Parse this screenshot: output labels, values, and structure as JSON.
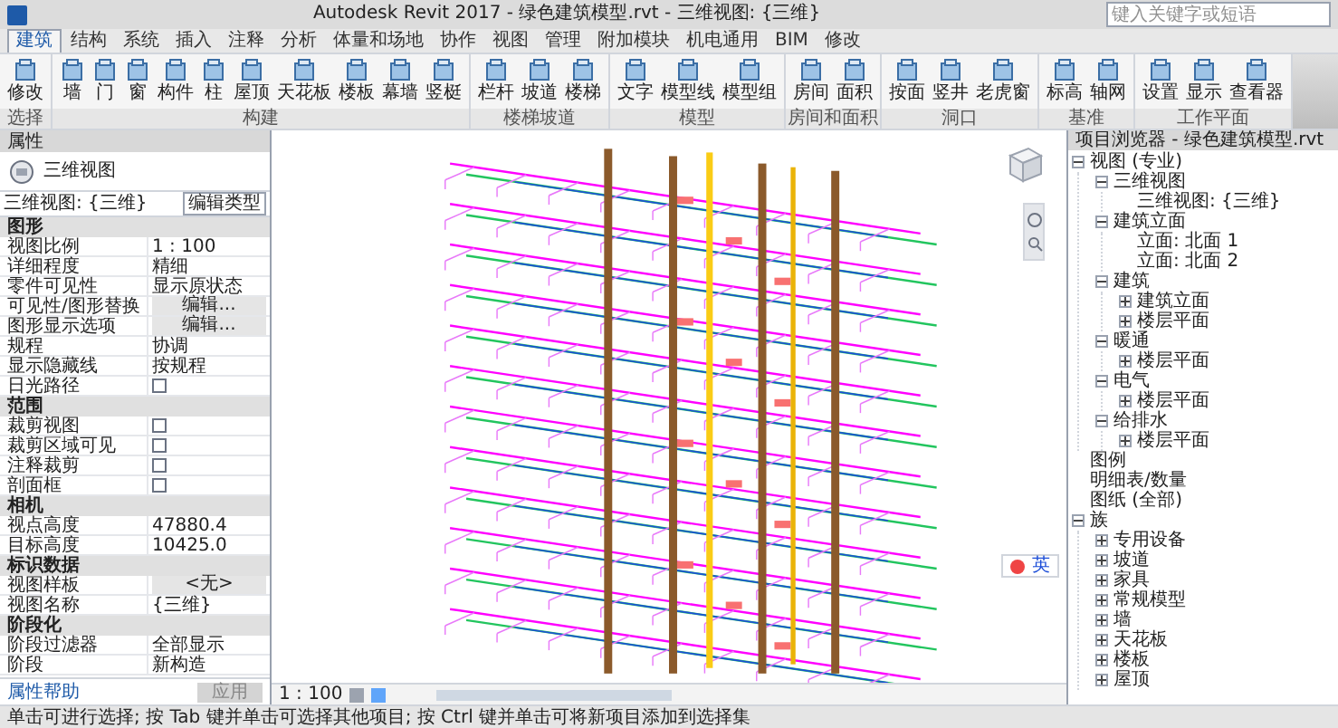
{
  "window": {
    "title": "Autodesk Revit 2017 -   绿色建筑模型.rvt - 三维视图: {三维}",
    "search": {
      "placeholder": "键入关键字或短语"
    }
  },
  "ribbon_tabs": [
    {
      "label": "建筑",
      "selected": true
    },
    {
      "label": "结构",
      "selected": false
    },
    {
      "label": "系统",
      "selected": false
    },
    {
      "label": "插入",
      "selected": false
    },
    {
      "label": "注释",
      "selected": false
    },
    {
      "label": "分析",
      "selected": false
    },
    {
      "label": "体量和场地",
      "selected": false
    },
    {
      "label": "协作",
      "selected": false
    },
    {
      "label": "视图",
      "selected": false
    },
    {
      "label": "管理",
      "selected": false
    },
    {
      "label": "附加模块",
      "selected": false
    },
    {
      "label": "机电通用",
      "selected": false
    },
    {
      "label": "BIM",
      "selected": false
    },
    {
      "label": "修改",
      "selected": false
    }
  ],
  "ribbon_panels": [
    {
      "label": "选择",
      "buttons": [
        "修改"
      ]
    },
    {
      "label": "构建",
      "buttons": [
        "墙",
        "门",
        "窗",
        "构件",
        "柱",
        "屋顶",
        "天花板",
        "楼板",
        "幕墙",
        "竖梃"
      ]
    },
    {
      "label": "楼梯坡道",
      "buttons": [
        "栏杆",
        "坡道",
        "楼梯"
      ]
    },
    {
      "label": "模型",
      "buttons": [
        "文字",
        "模型线",
        "模型组"
      ]
    },
    {
      "label": "房间和面积",
      "buttons": [
        "房间",
        "面积"
      ]
    },
    {
      "label": "洞口",
      "buttons": [
        "按面",
        "竖井",
        "老虎窗"
      ]
    },
    {
      "label": "基准",
      "buttons": [
        "标高",
        "轴网"
      ]
    },
    {
      "label": "工作平面",
      "buttons": [
        "设置",
        "显示",
        "查看器"
      ]
    }
  ],
  "properties": {
    "title": "属性",
    "type_name": "三维视图",
    "type_selector": "三维视图: {三维}",
    "edit_type": "编辑类型",
    "sections": [
      {
        "label": "图形",
        "rows": [
          {
            "kind": "text",
            "name": "视图比例",
            "value": "1 : 100"
          },
          {
            "kind": "text",
            "name": "详细程度",
            "value": "精细"
          },
          {
            "kind": "text",
            "name": "零件可见性",
            "value": "显示原状态"
          },
          {
            "kind": "button",
            "name": "可见性/图形替换",
            "value": "编辑..."
          },
          {
            "kind": "button",
            "name": "图形显示选项",
            "value": "编辑..."
          },
          {
            "kind": "text",
            "name": "规程",
            "value": "协调"
          },
          {
            "kind": "text",
            "name": "显示隐藏线",
            "value": "按规程"
          },
          {
            "kind": "checkbox",
            "name": "日光路径",
            "checked": false
          }
        ]
      },
      {
        "label": "范围",
        "rows": [
          {
            "kind": "checkbox",
            "name": "裁剪视图",
            "checked": false
          },
          {
            "kind": "checkbox",
            "name": "裁剪区域可见",
            "checked": false
          },
          {
            "kind": "checkbox",
            "name": "注释裁剪",
            "checked": false
          },
          {
            "kind": "checkbox",
            "name": "剖面框",
            "checked": false
          }
        ]
      },
      {
        "label": "相机",
        "rows": [
          {
            "kind": "text",
            "name": "视点高度",
            "value": "47880.4"
          },
          {
            "kind": "text",
            "name": "目标高度",
            "value": "10425.0"
          }
        ]
      },
      {
        "label": "标识数据",
        "rows": [
          {
            "kind": "button",
            "name": "视图样板",
            "value": "<无>"
          },
          {
            "kind": "text",
            "name": "视图名称",
            "value": "{三维}"
          }
        ]
      },
      {
        "label": "阶段化",
        "rows": [
          {
            "kind": "text",
            "name": "阶段过滤器",
            "value": "全部显示"
          },
          {
            "kind": "text",
            "name": "阶段",
            "value": "新构造"
          }
        ]
      }
    ],
    "help_link": "属性帮助",
    "apply": "应用"
  },
  "project_browser": {
    "title": "项目浏览器 - 绿色建筑模型.rvt",
    "tree": [
      {
        "label": "视图 (专业)",
        "expanded": true,
        "children": [
          {
            "label": "三维视图",
            "expanded": true,
            "children": [
              {
                "label": "三维视图: {三维}"
              }
            ]
          },
          {
            "label": "建筑立面",
            "expanded": true,
            "children": [
              {
                "label": "立面: 北面 1"
              },
              {
                "label": "立面: 北面 2"
              }
            ]
          },
          {
            "label": "建筑",
            "expanded": true,
            "children": [
              {
                "label": "建筑立面",
                "expanded": false
              },
              {
                "label": "楼层平面",
                "expanded": false
              }
            ]
          },
          {
            "label": "暖通",
            "expanded": true,
            "children": [
              {
                "label": "楼层平面",
                "expanded": false
              }
            ]
          },
          {
            "label": "电气",
            "expanded": true,
            "children": [
              {
                "label": "楼层平面",
                "expanded": false
              }
            ]
          },
          {
            "label": "给排水",
            "expanded": true,
            "children": [
              {
                "label": "楼层平面",
                "expanded": false
              }
            ]
          }
        ]
      },
      {
        "label": "图例"
      },
      {
        "label": "明细表/数量"
      },
      {
        "label": "图纸 (全部)"
      },
      {
        "label": "族",
        "expanded": true,
        "children": [
          {
            "label": "专用设备",
            "expanded": false
          },
          {
            "label": "坡道",
            "expanded": false
          },
          {
            "label": "家具",
            "expanded": false
          },
          {
            "label": "常规模型",
            "expanded": false
          },
          {
            "label": "墙",
            "expanded": false
          },
          {
            "label": "天花板",
            "expanded": false
          },
          {
            "label": "楼板",
            "expanded": false
          },
          {
            "label": "屋顶",
            "expanded": false
          }
        ]
      }
    ]
  },
  "view_bar": {
    "scale": "1 : 100"
  },
  "ime_toolbar": {
    "label": "英"
  },
  "status_bar": {
    "text": "单击可进行选择; 按 Tab 键并单击可选择其他项目; 按 Ctrl 键并单击可将新项目添加到选择集"
  }
}
